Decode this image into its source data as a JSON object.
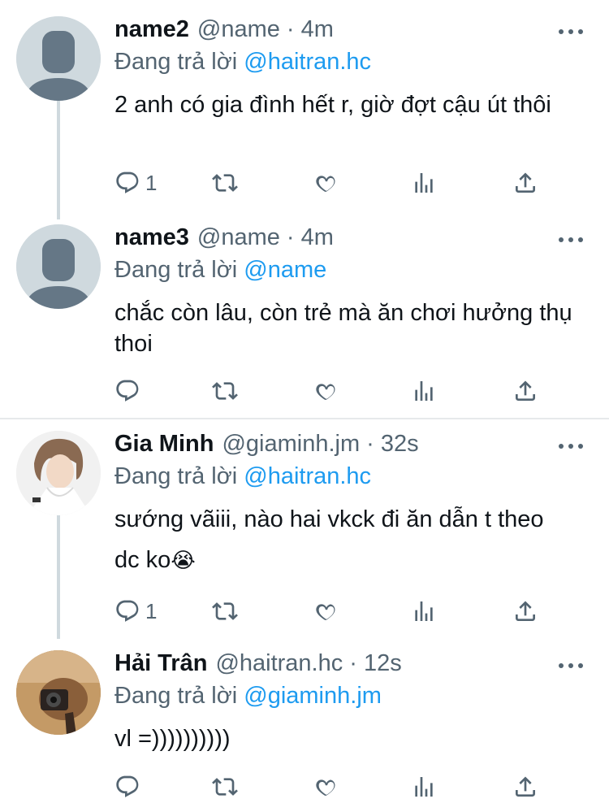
{
  "tweets": [
    {
      "name": "name2",
      "meta": "@name · 4m",
      "replying_prefix": "Đang trả lời",
      "replying_to": "@haitran.hc",
      "text": "2 anh có gia đình hết r, giờ đợt cậu út thôi",
      "reply_count": "1",
      "avatar": "default-avatar-icon"
    },
    {
      "name": "name3",
      "meta": "@name · 4m",
      "replying_prefix": "Đang trả lời",
      "replying_to": "@name",
      "text": "chắc còn lâu, còn trẻ mà ăn chơi hưởng thụ thoi",
      "reply_count": "",
      "avatar": "default-avatar-icon"
    },
    {
      "name": "Gia Minh",
      "meta": "@giaminh.jm · 32s",
      "replying_prefix": "Đang trả lời",
      "replying_to": "@haitran.hc",
      "text": "sướng vãiii, nào hai vkck đi ăn dẫn t theo dc ko",
      "emoji": "😭",
      "reply_count": "1",
      "avatar": "profile-photo"
    },
    {
      "name": "Hải Trân",
      "meta": "@haitran.hc · 12s",
      "replying_prefix": "Đang trả lời",
      "replying_to": "@giaminh.jm",
      "text": "vl =))))))))))",
      "reply_count": "",
      "avatar": "profile-photo"
    }
  ],
  "colors": {
    "accent": "#1d9bf0",
    "secondary_text": "#536471",
    "thread_line": "#cfd9de"
  }
}
